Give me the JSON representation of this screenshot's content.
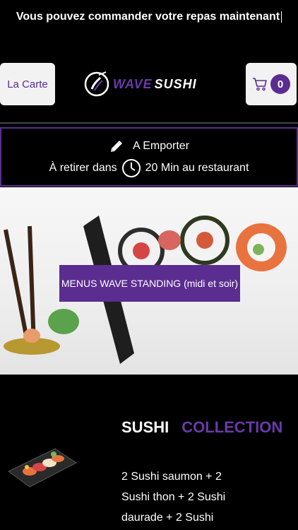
{
  "banner": {
    "text": "Vous pouvez commander votre repas maintenant"
  },
  "header": {
    "menu_label": "La Carte",
    "logo_wave": "WAVE",
    "logo_sushi": "SUSHI",
    "cart_count": "0"
  },
  "order": {
    "mode": "A Emporter",
    "pickup_prefix": "À retirer dans",
    "pickup_suffix": "20 Min au restaurant"
  },
  "hero": {
    "button_label": "MENUS WAVE STANDING (midi et soir)"
  },
  "collection": {
    "title_white": "SUSHI",
    "title_purple": "COLLECTION",
    "description": "2 Sushi saumon + 2 Sushi thon + 2 Sushi daurade + 2 Sushi"
  },
  "colors": {
    "brand_purple": "#5b2d90",
    "background": "#000000",
    "button_bg": "#f2f2f2"
  }
}
